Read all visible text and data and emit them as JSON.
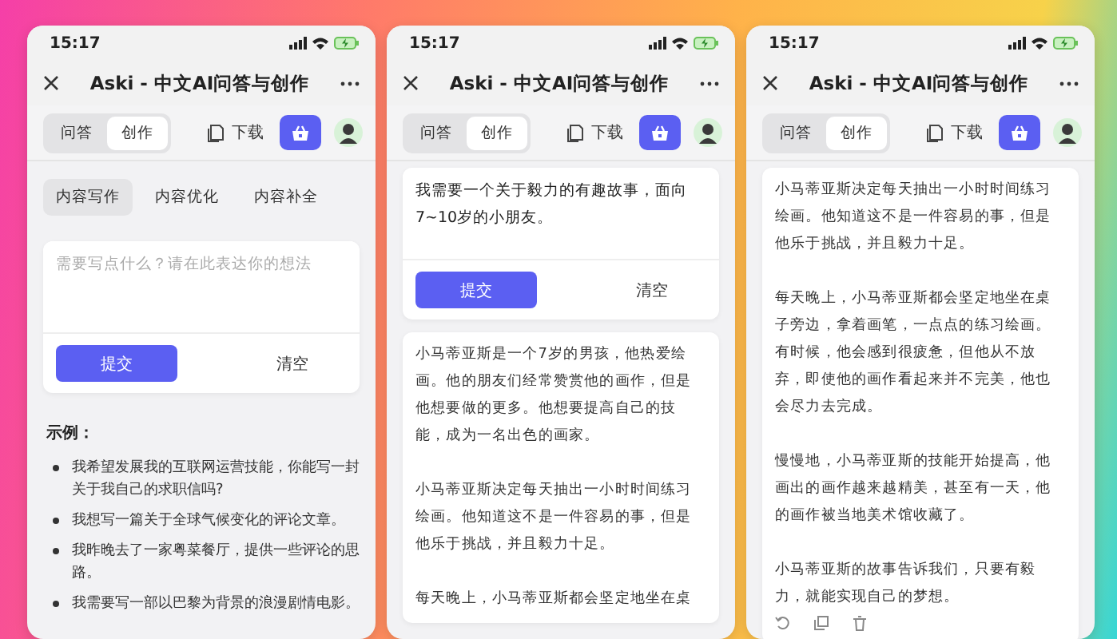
{
  "phones": [
    {
      "status_bar": {
        "time": "15:17"
      },
      "title": "Aski - 中文AI问答与创作",
      "mode_tabs": [
        {
          "label": "问答",
          "selected": false
        },
        {
          "label": "创作",
          "selected": true
        }
      ],
      "download": "下载",
      "content": [
        {
          "kind": "subtabs",
          "tabs": [
            {
              "label": "内容写作",
              "selected": true
            },
            {
              "label": "内容优化",
              "selected": false
            },
            {
              "label": "内容补全",
              "selected": false
            }
          ]
        },
        {
          "kind": "prompt_card",
          "placeholder": "需要写点什么？请在此表达你的想法",
          "submit": "提交",
          "clear": "清空"
        },
        {
          "kind": "examples",
          "heading": "示例：",
          "items": [
            "我希望发展我的互联网运营技能，你能写一封关于我自己的求职信吗?",
            "我想写一篇关于全球气候变化的评论文章。",
            "我昨晚去了一家粤菜餐厅，提供一些评论的思路。",
            "我需要写一部以巴黎为背景的浪漫剧情电影。"
          ]
        }
      ]
    },
    {
      "status_bar": {
        "time": "15:17"
      },
      "title": "Aski - 中文AI问答与创作",
      "mode_tabs": [
        {
          "label": "问答",
          "selected": false
        },
        {
          "label": "创作",
          "selected": true
        }
      ],
      "download": "下载",
      "content": [
        {
          "kind": "prompt_card",
          "value": "我需要一个关于毅力的有趣故事，面向7~10岁的小朋友。",
          "submit": "提交",
          "clear": "清空"
        },
        {
          "kind": "answer_card",
          "paragraphs": [
            "小马蒂亚斯是一个7岁的男孩，他热爱绘画。他的朋友们经常赞赏他的画作，但是他想要做的更多。他想要提高自己的技能，成为一名出色的画家。",
            "小马蒂亚斯决定每天抽出一小时时间练习绘画。他知道这不是一件容易的事，但是他乐于挑战，并且毅力十足。",
            "每天晚上，小马蒂亚斯都会坚定地坐在桌"
          ]
        }
      ]
    },
    {
      "status_bar": {
        "time": "15:17"
      },
      "title": "Aski - 中文AI问答与创作",
      "mode_tabs": [
        {
          "label": "问答",
          "selected": false
        },
        {
          "label": "创作",
          "selected": true
        }
      ],
      "download": "下载",
      "content": [
        {
          "kind": "answer_card",
          "actions": true,
          "paragraphs": [
            "小马蒂亚斯决定每天抽出一小时时间练习绘画。他知道这不是一件容易的事，但是他乐于挑战，并且毅力十足。",
            "每天晚上，小马蒂亚斯都会坚定地坐在桌子旁边，拿着画笔，一点点的练习绘画。有时候，他会感到很疲惫，但他从不放弃，即使他的画作看起来并不完美，他也会尽力去完成。",
            "慢慢地，小马蒂亚斯的技能开始提高，他画出的画作越来越精美，甚至有一天，他的画作被当地美术馆收藏了。",
            "小马蒂亚斯的故事告诉我们，只要有毅力，就能实现自己的梦想。"
          ]
        }
      ]
    }
  ]
}
